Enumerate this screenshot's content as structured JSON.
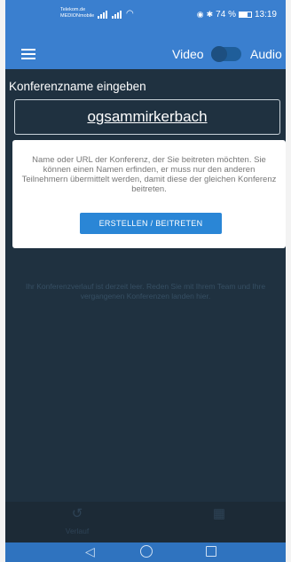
{
  "status_bar": {
    "carrier_line1": "Telekom.de",
    "carrier_line2": "MEDIONmobile",
    "battery": "74 %",
    "time": "13:19"
  },
  "app_bar": {
    "video_label": "Video",
    "audio_label": "Audio",
    "toggle_on": false
  },
  "room": {
    "prompt": "Konferenzname eingeben",
    "value": "ogsammirkerbach"
  },
  "info_card": {
    "text": "Name oder URL der Konferenz, der Sie beitreten möchten. Sie können einen Namen erfinden, er muss nur den anderen Teilnehmern übermittelt werden, damit diese der gleichen Konferenz beitreten.",
    "button_label": "ERSTELLEN / BEITRETEN"
  },
  "empty_history": "Ihr Konferenzverlauf ist derzeit leer. Reden Sie mit Ihrem Team und Ihre vergangenen Konferenzen landen hier.",
  "bottom_nav": {
    "history_label": "Verlauf",
    "history_icon": "history-icon",
    "calendar_icon": "calendar-icon"
  },
  "colors": {
    "accent": "#3a7fcf",
    "background": "#1f3140",
    "button": "#2a86d6"
  }
}
